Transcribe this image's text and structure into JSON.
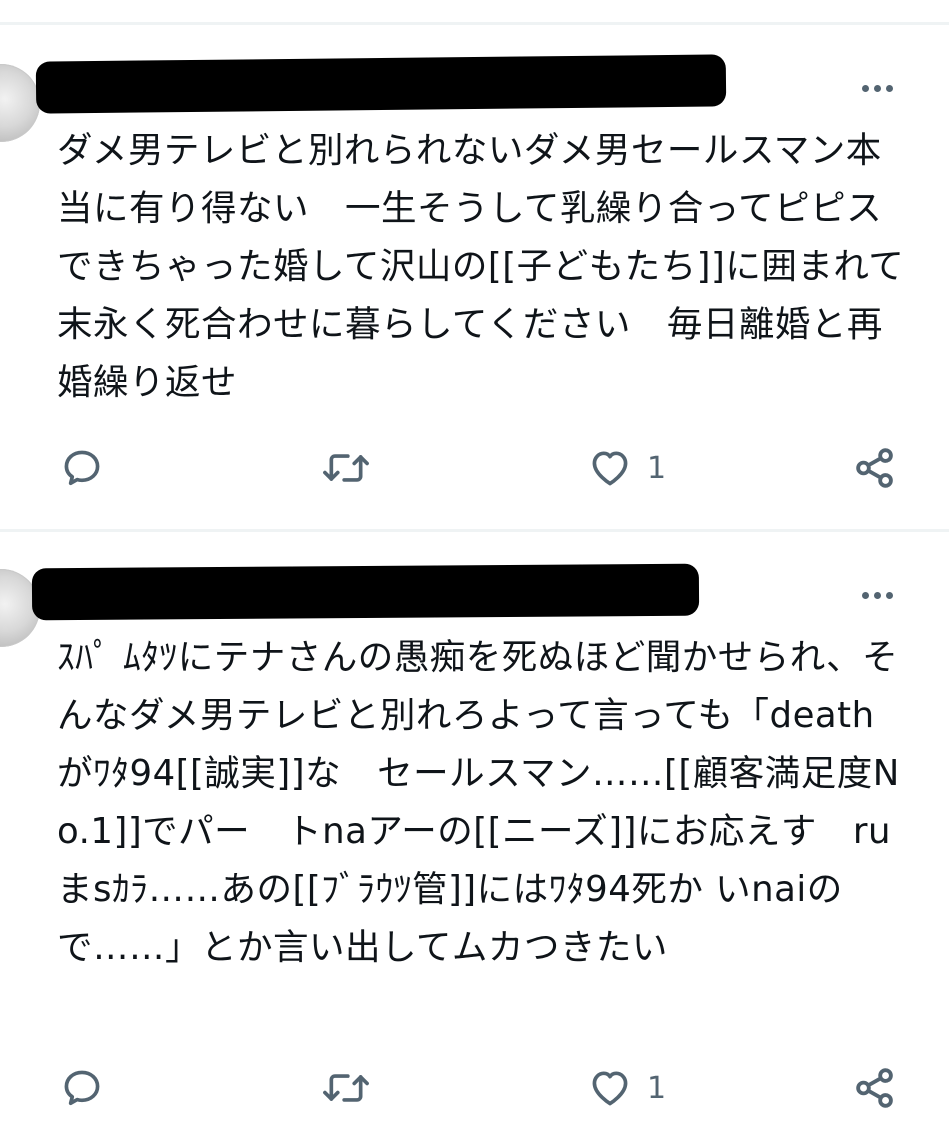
{
  "posts": [
    {
      "text": "ダメ男テレビと別れられないダメ男セールスマン本当に有り得ない　一生そうして乳繰り合ってピピスできちゃった婚して沢山の[[子どもたち]]に囲まれて末永く死合わせに暮らしてください　毎日離婚と再婚繰り返せ",
      "like_count": "1",
      "icons": {
        "reply": "reply-icon",
        "retweet": "retweet-icon",
        "like": "heart-icon",
        "share": "share-icon",
        "more": "more-options-icon"
      }
    },
    {
      "text": "ｽﾊﾟ ﾑﾀﾂにテナさんの愚痴を死ぬほど聞かせられ、そんなダメ男テレビと別れろよって言っても「deathがﾜﾀ94[[誠実]]な　セールスマン……[[顧客満足度No.1]]でパー　トnaアーの[[ニーズ]]にお応えす　ruまsｶﾗ……あの[[ﾌﾞﾗｳﾂ管]]にはﾜﾀ94死か いnaiので……」とか言い出してムカつきたい",
      "like_count": "1",
      "icons": {
        "reply": "reply-icon",
        "retweet": "retweet-icon",
        "like": "heart-icon",
        "share": "share-icon",
        "more": "more-options-icon"
      }
    }
  ],
  "colors": {
    "text": "#0f1419",
    "secondary": "#536471",
    "divider": "#eff3f4",
    "redaction": "#000000"
  }
}
